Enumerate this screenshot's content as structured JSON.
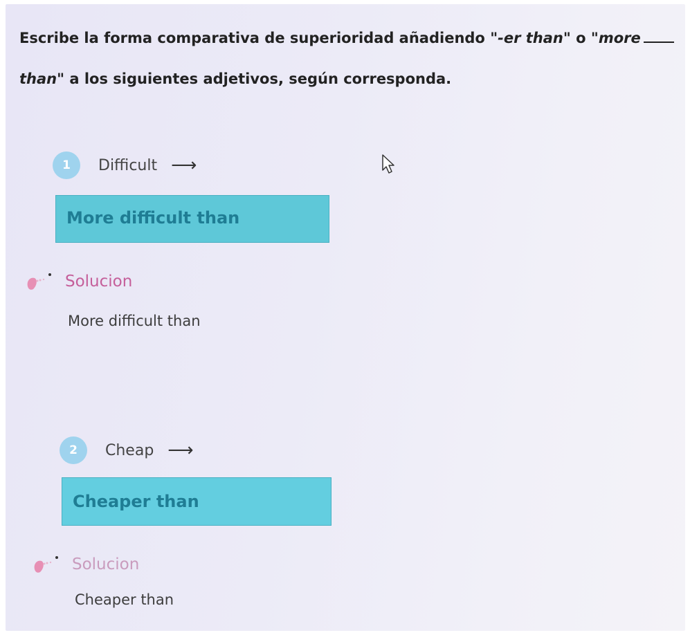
{
  "instruction": {
    "part1": "Escribe la forma comparativa de superioridad añadiendo ",
    "quote1": "\"-er than\"",
    "part2": " o ",
    "quote2_start": "\"more",
    "quote2_end": "than\"",
    "part3": " a los siguientes adjetivos, según corresponda."
  },
  "questions": [
    {
      "number": "1",
      "word": "Difficult",
      "arrow": "⟶",
      "answer": "More difficult than",
      "solution_label": "Solucion",
      "solution": "More difficult than"
    },
    {
      "number": "2",
      "word": "Cheap",
      "arrow": "⟶",
      "answer": "Cheaper than",
      "solution_label": "Solucion",
      "solution": "Cheaper than"
    }
  ],
  "colors": {
    "badge": "#9fd3ee",
    "answer_box": "#5ec8d8",
    "answer_text": "#1f7d94",
    "solution_label": "#c55f9a"
  }
}
